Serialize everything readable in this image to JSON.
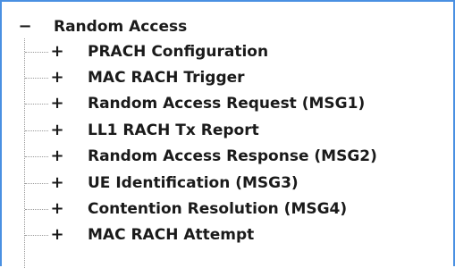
{
  "tree": {
    "root": {
      "toggle": "−",
      "label": "Random Access"
    },
    "children": [
      {
        "toggle": "+",
        "label": "PRACH Configuration"
      },
      {
        "toggle": "+",
        "label": "MAC RACH Trigger"
      },
      {
        "toggle": "+",
        "label": "Random Access Request (MSG1)"
      },
      {
        "toggle": "+",
        "label": "LL1 RACH Tx Report"
      },
      {
        "toggle": "+",
        "label": "Random Access Response (MSG2)"
      },
      {
        "toggle": "+",
        "label": "UE Identification (MSG3)"
      },
      {
        "toggle": "+",
        "label": "Contention Resolution (MSG4)"
      },
      {
        "toggle": "+",
        "label": "MAC RACH Attempt"
      }
    ]
  },
  "colors": {
    "border_accent": "#4a90e2",
    "text": "#1a1a1a",
    "guide_line": "#9a9a9a"
  },
  "icons": {
    "expanded": "minus-icon",
    "collapsed": "plus-icon"
  }
}
